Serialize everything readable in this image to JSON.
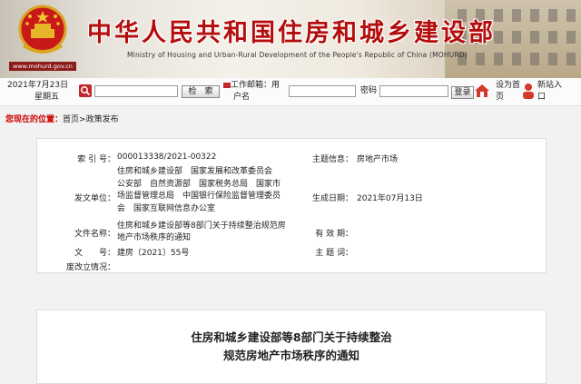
{
  "banner": {
    "title": "中华人民共和国住房和城乡建设部",
    "subtitle": "Ministry of Housing and Urban-Rural Development of the People's Republic of China (MOHURD)",
    "url": "www.mohurd.gov.cn"
  },
  "topbar": {
    "date": "2021年7月23日",
    "weekday": "星期五",
    "search_button": "检　索",
    "workspace_label": "工作邮箱：",
    "user_label": "用",
    "user_label2": "户名",
    "password_label": "密码",
    "login_button": "登录",
    "set_home": "设为首页",
    "register": "新站入口"
  },
  "breadcrumb": {
    "label": "您现在的位置：",
    "home": "首页",
    "sep": ">",
    "section": "政策发布"
  },
  "meta": {
    "index_key": "索 引 号：",
    "index_val": "000013338/2021-00322",
    "topic_key": "主题信息：",
    "topic_val": "房地产市场",
    "issuer_key": "发文单位：",
    "issuer_val_1": "住房和城乡建设部　国家发展和改革委员会",
    "issuer_val_2": "公安部　自然资源部　国家税务总局　国家市",
    "issuer_val_3": "场监督管理总局　中国银行保险监督管理委员",
    "issuer_val_4": "会　国家互联网信息办公室",
    "date_key": "生成日期：",
    "date_val": "2021年07月13日",
    "name_key": "文件名称：",
    "name_val_1": "住房和城乡建设部等8部门关于持续整治规范房",
    "name_val_2": "地产市场秩序的通知",
    "validity_key": "有 效 期：",
    "docno_key": "文　　号：",
    "docno_val": "建房〔2021〕55号",
    "subject_key": "主 题 词：",
    "status_key": "废改立情况："
  },
  "document": {
    "title_line1": "住房和城乡建设部等8部门关于持续整治",
    "title_line2": "规范房地产市场秩序的通知"
  },
  "colors": {
    "brand_red": "#b40d0d",
    "breadcrumb_red": "#cc0000"
  }
}
